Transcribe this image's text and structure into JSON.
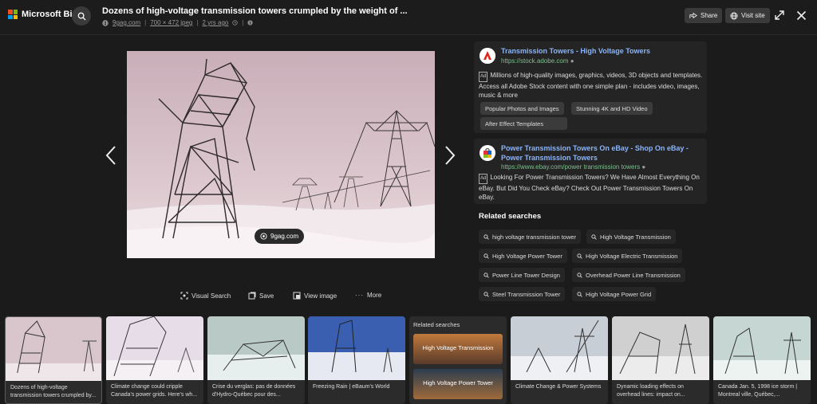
{
  "header": {
    "brand": "Microsoft Bing",
    "title": "Dozens of high-voltage transmission towers crumpled by the weight of ...",
    "source_domain": "9gag.com",
    "dimensions": "700 × 472 jpeg",
    "age": "2 yrs ago",
    "share_label": "Share",
    "visit_label": "Visit site"
  },
  "viewer": {
    "source_chip": "9gag.com",
    "actions": {
      "visual_search": "Visual Search",
      "save": "Save",
      "view_image": "View image",
      "more": "More"
    }
  },
  "ads": [
    {
      "title": "Transmission Towers - High Voltage Towers",
      "url": "https://stock.adobe.com",
      "tag": "Ad",
      "desc": "Millions of high-quality images, graphics, videos, 3D objects and templates. Access all Adobe Stock content with one simple plan - includes video, images, music & more",
      "chips": [
        "Popular Photos and Images",
        "Stunning 4K and HD Video",
        "After Effect Templates"
      ]
    },
    {
      "title": "Power Transmission Towers On eBay - Shop On eBay - Power Transmission Towers",
      "url": "https://www.ebay.com/power transmission towers",
      "tag": "Ad",
      "desc": "Looking For Power Transmission Towers? We Have Almost Everything On eBay. But Did You Check eBay? Check Out Power Transmission Towers On eBay."
    }
  ],
  "related": {
    "title": "Related searches",
    "items": [
      "high voltage transmission tower",
      "High Voltage Transmission",
      "High Voltage Power Tower",
      "High Voltage Electric Transmission",
      "Power Line Tower Design",
      "Overhead Power Line Transmission",
      "Steel Transmission Tower",
      "High Voltage Power Grid"
    ]
  },
  "strip": {
    "related_head": "Related searches",
    "related_items": [
      "High Voltage Transmission",
      "High Voltage Power Tower"
    ],
    "thumbs": [
      "Dozens of high-voltage transmission towers crumpled by...",
      "Climate change could cripple Canada's power grids. Here's wh...",
      "Crise du verglas: pas de données d'Hydro-Québec pour des...",
      "Freezing Rain | eBaum's World",
      "Climate Change & Power Systems",
      "Dynamic loading effects on overhead lines: impact on...",
      "Canada Jan. 5, 1998 ice storm | Montreal ville, Québec,..."
    ]
  },
  "colors": {
    "background": "#1b1b1b",
    "link": "#8ab4f8",
    "url_green": "#7fbf8f"
  }
}
